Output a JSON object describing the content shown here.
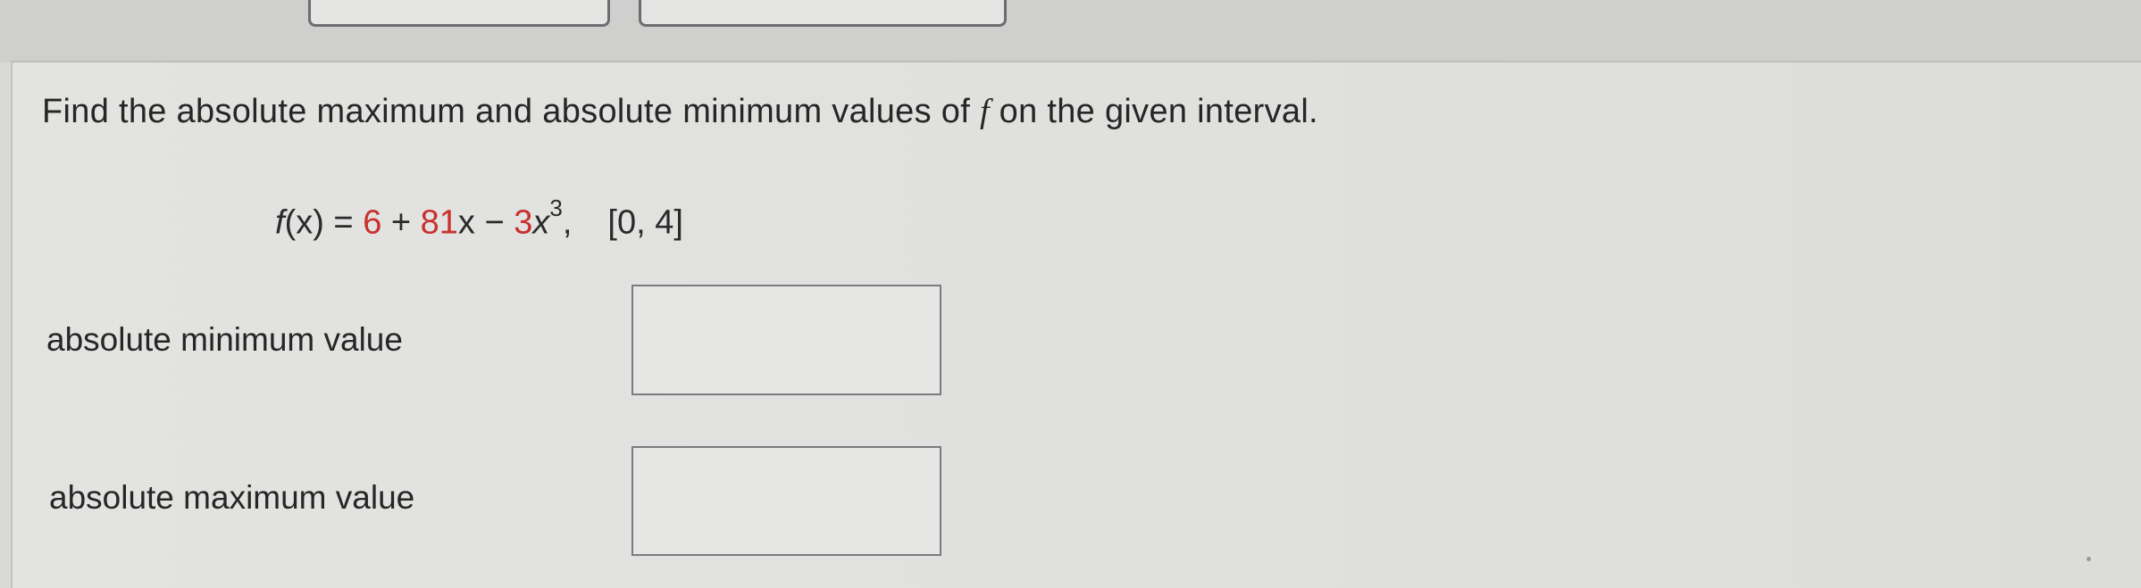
{
  "question": {
    "text_before": "Find the absolute maximum and absolute minimum values of ",
    "variable": "f",
    "text_after": " on the given interval."
  },
  "formula": {
    "lhs_name": "f",
    "lhs_arg": "(x)",
    "equals": " = ",
    "term1": "6",
    "plus": " + ",
    "term2_coef": "81",
    "term2_var": "x",
    "minus": " − ",
    "term3_coef": "3",
    "term3_var": "x",
    "term3_exp": "3",
    "comma": ",",
    "interval": "[0, 4]"
  },
  "fields": {
    "min_label": "absolute minimum value",
    "min_value": "",
    "max_label": "absolute maximum value",
    "max_value": ""
  },
  "colors": {
    "red_value": "#c8312f",
    "text": "#262626"
  }
}
